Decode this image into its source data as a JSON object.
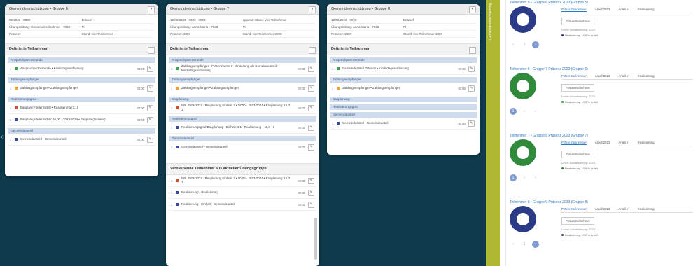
{
  "colors": {
    "page_bg": "#0e3a4c",
    "group_bg": "#cfdcee",
    "accent": "#2f76c0",
    "stripe": "#b0b833",
    "pie_navy": "#2b3b88",
    "pie_green": "#2f8a3c"
  },
  "card1": {
    "title": "Gemeindeeinschätzung • Gruppe 6",
    "meta": [
      [
        "09/2023 · 0000",
        "Entwurf"
      ],
      [
        "Übungsleitung: Gemeindeteilnehmer · 7038",
        "Pl"
      ],
      [
        "Präsenz",
        "Stand: vier Teilnehmer"
      ]
    ],
    "section": "Definierte Teilnehmer",
    "groups": [
      {
        "label": "Ansprechpartnerrunde",
        "rows": [
          {
            "count": "1",
            "color": "#3aa54b",
            "text": "Ansprechpartnerrunde • Kindertageserfassung",
            "pct": "00:00"
          }
        ]
      },
      {
        "label": "Zahlungsempfänger",
        "rows": [
          {
            "count": "1",
            "color": "#e8a33a",
            "text": "Zahlungsempfänger • Zahlungsempfänger",
            "pct": "00:00"
          }
        ]
      },
      {
        "label": "Realisierungsgrad",
        "rows": [
          {
            "count": "1",
            "color": "#d24a3a",
            "text": "Bauplan (Fördermittel) • Realisierung (1:1)",
            "pct": "00:00"
          },
          {
            "count": "1",
            "color": "#3b4b9c",
            "text": "Bauplan (Fördermittel): 10,00 · 2023-2024 • Bauplan (Gesamt)",
            "pct": "00:00"
          }
        ]
      },
      {
        "label": "Gemeindeanteil",
        "rows": [
          {
            "count": "1",
            "color": "#3b4b9c",
            "text": "Gemeindeanteil • Gemeindeanteil",
            "pct": "00:00"
          }
        ]
      }
    ]
  },
  "card2": {
    "title": "Gemeindeeinschätzung • Gruppe 7",
    "meta": [
      [
        "12/09/2023 · 0000 · 0000",
        "eppend: Stand: vier Teilnehmer"
      ],
      [
        "Übungsleitung: Anna-Maria · 7038",
        "Pl"
      ],
      [
        "Präsenz: 2023",
        "Stand: vier Teilnehmer 2023"
      ]
    ],
    "section": "Definierte Teilnehmer",
    "groups": [
      {
        "label": "Ansprechpartnerrunde",
        "rows": [
          {
            "count": "1",
            "color": "#3aa54b",
            "text": "Zahlungsempfänger · Präsenzwerte 0 · Erfassung als Gemeindeanteil • Kindertageserfassung",
            "pct": "00:00"
          }
        ]
      },
      {
        "label": "Zahlungsempfänger",
        "rows": [
          {
            "count": "1",
            "color": "#e8a33a",
            "text": "Zahlungsempfänger • Zahlungsempfänger",
            "pct": "00:00"
          }
        ]
      },
      {
        "label": "Bauplanung",
        "rows": [
          {
            "count": "1",
            "color": "#d24a3a",
            "text": "NR. 2023-2024 · Bauplanung Einheit: 1 • 1/000 · 2023-2024 • Bauplanung: 10,0 · 1",
            "pct": "00:00"
          }
        ]
      },
      {
        "label": "Realisierungsgrad",
        "rows": [
          {
            "count": "1",
            "color": "#3b4b9c",
            "text": "Realisierungsgrad Bauplanung · Einheit: 1:1 • Realisierung · 10,0 · 1",
            "pct": "00:00"
          }
        ]
      },
      {
        "label": "Gemeindeanteil",
        "rows": [
          {
            "count": "1",
            "color": "#3b4b9c",
            "text": "Gemeindeanteil • Gemeindeanteil",
            "pct": "00:00"
          }
        ]
      }
    ],
    "section2": "Verbleibende Teilnehmer aus aktueller Übungsgruppe",
    "rows2": [
      {
        "count": "1",
        "color": "#d24a3a",
        "text": "NR. 2023-2024 · Bauplanung Einheit: 1 • 10,00 · 2023-2024 • Bauplanung: 10,0 · 1",
        "pct": "00:00"
      },
      {
        "count": "1",
        "color": "#3b4b9c",
        "text": "Realisierung • Realisierung",
        "pct": "00:00"
      },
      {
        "count": "1",
        "color": "#3b4b9c",
        "text": "Realisierung · Einheit • Gemeindeanteil",
        "pct": "00:00"
      }
    ]
  },
  "card3": {
    "title": "Gemeindeeinschätzung • Gruppe 8",
    "meta": [
      [
        "12/09/2023 · 0000",
        "Entwurf"
      ],
      [
        "Übungsleitung: Anna-Maria · 7038",
        "Pl"
      ],
      [
        "Präsenz: 2023",
        "Stand: vier Teilnehmer 2023"
      ]
    ],
    "section": "Definierte Teilnehmer",
    "groups": [
      {
        "label": "Ansprechpartnerrunde",
        "rows": [
          {
            "count": "1",
            "color": "#3aa54b",
            "text": "Gemeindeanteil Präsenz • Kindertageserfassung",
            "pct": "00:00"
          }
        ]
      },
      {
        "label": "Zahlungsempfänger",
        "rows": [
          {
            "count": "1",
            "color": "#e8a33a",
            "text": "Zahlungsempfänger • Zahlungsempfänger",
            "pct": "00:00"
          }
        ]
      },
      {
        "label": "Bauplanung",
        "rows": []
      },
      {
        "label": "Realisierungsgrad",
        "rows": []
      },
      {
        "label": "Gemeindeanteil",
        "rows": [
          {
            "count": "1",
            "color": "#3b4b9c",
            "text": "Gemeindeanteil • Gemeindeanteil",
            "pct": "00:00"
          }
        ]
      }
    ]
  },
  "panel": {
    "stripe_text": "Gemeindeeinschätzung",
    "items": [
      {
        "title": "Teilnehmer 5 • Gruppe 6 Präsenz 2023 (Gruppe 5)",
        "pie": "navy",
        "tabs": [
          "Präsenzteilnehmer",
          "Anteil 2023",
          "Anteil in",
          "Realisierung"
        ],
        "button": "Präsenzteilnehmer",
        "sub": "Letzte Aktualisierung: 2023",
        "legend": "Realisierung 10,0 % Anteil",
        "pages": [
          "‹",
          "1",
          "›"
        ],
        "cur": 2
      },
      {
        "title": "Teilnehmer 6 • Gruppe 7 Präsenz 2023 (Gruppe 6)",
        "pie": "green",
        "tabs": [
          "Präsenzteilnehmer",
          "Anteil 2023",
          "Anteil in",
          "Realisierung"
        ],
        "button": "Präsenzteilnehmer",
        "sub": "Letzte Aktualisierung: 2023",
        "legend": "Realisierung 10,0 % Anteil",
        "pages": [
          "1",
          "‹",
          "›"
        ],
        "cur": 0
      },
      {
        "title": "Teilnehmer 7 • Gruppe 8 Präsenz 2023 (Gruppe 7)",
        "pie": "green",
        "tabs": [
          "Präsenzteilnehmer",
          "Anteil 2023",
          "Anteil in",
          "Realisierung"
        ],
        "button": "Präsenzteilnehmer",
        "sub": "Letzte Aktualisierung: 2023",
        "legend": "Realisierung 10,0 % Anteil",
        "pages": [
          "1",
          "‹",
          "›"
        ],
        "cur": 0
      },
      {
        "title": "Teilnehmer 8 • Gruppe 9 Präsenz 2023 (Gruppe 8)",
        "pie": "navy",
        "tabs": [
          "Präsenzteilnehmer",
          "Anteil 2023",
          "Anteil in",
          "Realisierung"
        ],
        "button": "Präsenzteilnehmer",
        "sub": "Letzte Aktualisierung: 2023",
        "legend": "Realisierung 10,0 % Anteil",
        "pages": [
          "‹",
          "1",
          "›"
        ],
        "cur": 2
      }
    ]
  }
}
